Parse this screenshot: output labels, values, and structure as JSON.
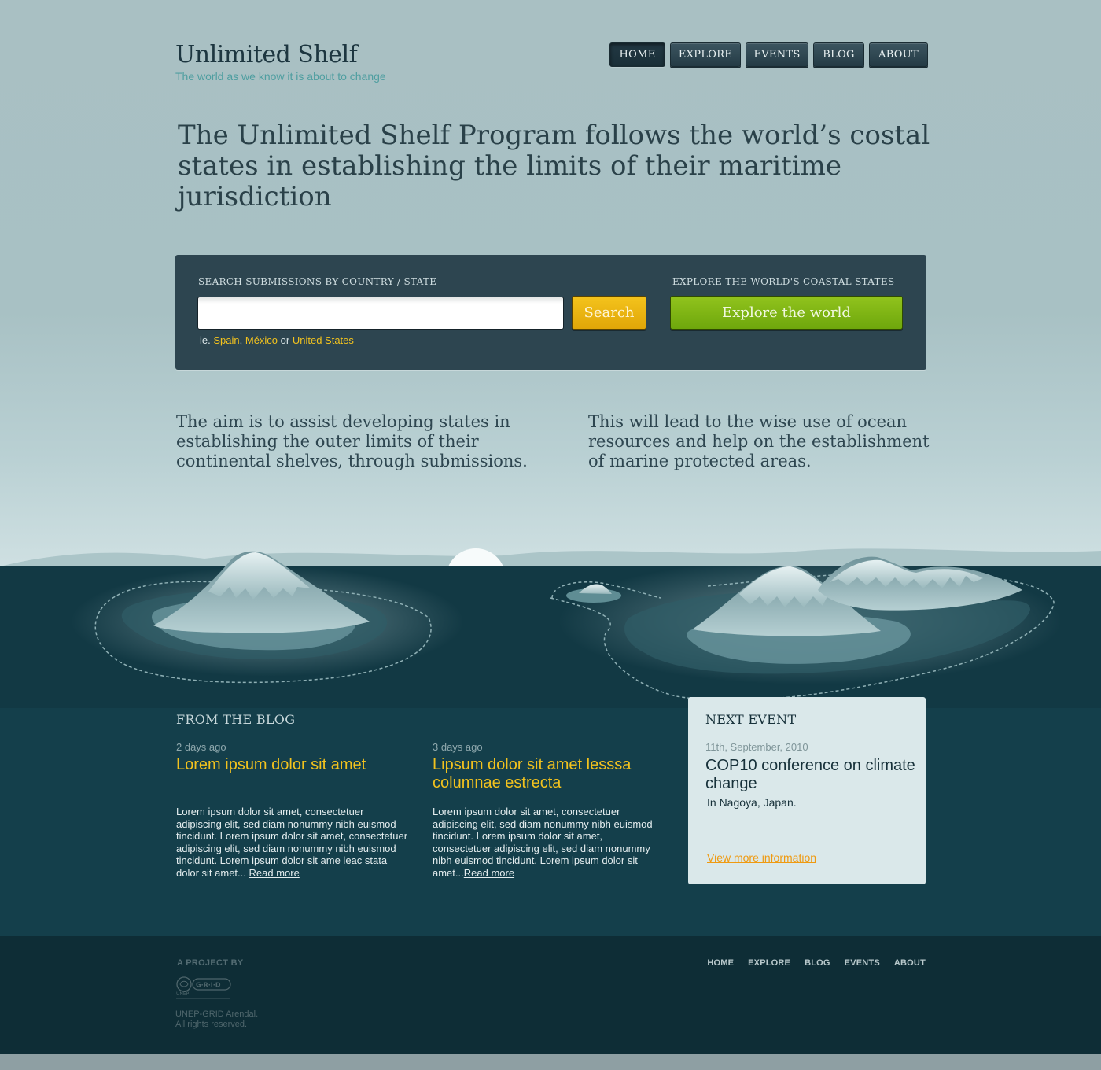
{
  "brand": {
    "title": "Unlimited Shelf",
    "tagline": "The world as we know it is about to change"
  },
  "nav": {
    "items": [
      {
        "label": "HOME",
        "active": true
      },
      {
        "label": "EXPLORE",
        "active": false
      },
      {
        "label": "EVENTS",
        "active": false
      },
      {
        "label": "BLOG",
        "active": false
      },
      {
        "label": "ABOUT",
        "active": false
      }
    ]
  },
  "hero": {
    "headline": "The Unlimited Shelf Program follows the world’s costal states in establishing the limits of their maritime jurisdiction"
  },
  "search": {
    "label": "SEARCH SUBMISSIONS BY COUNTRY / STATE",
    "input_value": "",
    "button": "Search",
    "example_prefix": "ie.",
    "example_sep1": ",",
    "example_sep2": "or",
    "examples": [
      "Spain",
      "México",
      "United States"
    ]
  },
  "explore": {
    "label": "EXPLORE THE WORLD'S COASTAL STATES",
    "button": "Explore the world"
  },
  "aims": [
    "The aim is to assist developing states in establishing the outer limits of their continental shelves, through submissions.",
    "This will lead to the wise use of ocean resources and help on the establishment of marine protected areas."
  ],
  "blog": {
    "heading": "FROM THE BLOG",
    "posts": [
      {
        "age": "2 days ago",
        "title": "Lorem ipsum dolor sit amet",
        "body": "Lorem ipsum dolor sit amet, consectetuer adipiscing elit, sed diam nonummy nibh euismod tincidunt. Lorem ipsum dolor sit amet, consectetuer adipiscing elit, sed diam nonummy nibh euismod tincidunt. Lorem ipsum dolor sit ame leac stata dolor sit amet...",
        "read_more": "Read more"
      },
      {
        "age": "3 days ago",
        "title": "Lipsum dolor sit amet  lesssa columnae estrecta",
        "body": "Lorem ipsum dolor sit amet, consectetuer adipiscing elit, sed diam nonummy nibh euismod tincidunt. Lorem ipsum dolor sit amet, consectetuer adipiscing elit, sed diam nonummy nibh euismod tincidunt. Lorem ipsum dolor sit amet...",
        "read_more": "Read more"
      }
    ]
  },
  "event": {
    "heading": "NEXT EVENT",
    "date": "11th, September, 2010",
    "title": "COP10 conference on climate change",
    "place": "In Nagoya, Japan.",
    "link": "View more information"
  },
  "footer": {
    "project_label": "A PROJECT BY",
    "logo_text": "UNEP GRID ARENDAL",
    "copyright_line1": "UNEP-GRID Arendal.",
    "copyright_line2": "All rights reserved.",
    "nav": [
      "HOME",
      "EXPLORE",
      "BLOG",
      "EVENTS",
      "ABOUT"
    ]
  },
  "colors": {
    "accent_yellow": "#f2c21e",
    "accent_green": "#7cb414",
    "accent_orange": "#ef9a10",
    "sky": "#a9c0c3",
    "sea": "#143f4b",
    "panel": "#2d4550"
  }
}
